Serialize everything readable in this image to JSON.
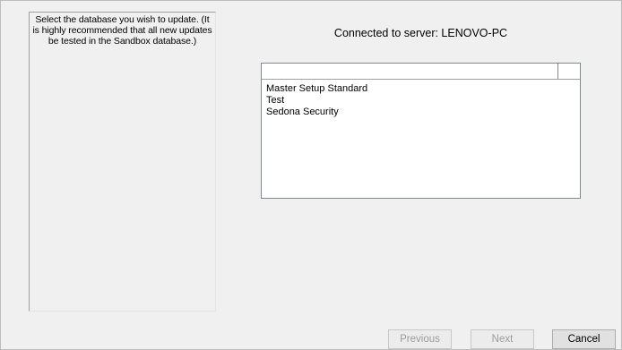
{
  "instructions": {
    "text": "Select the database you wish to update. (It is highly recommended that all new updates be tested in the Sandbox database.)"
  },
  "server": {
    "label": "Connected to server: LENOVO-PC"
  },
  "database_list": {
    "columns": [
      "",
      ""
    ],
    "items": [
      {
        "label": "Master Setup Standard"
      },
      {
        "label": "Test"
      },
      {
        "label": "Sedona Security"
      }
    ]
  },
  "buttons": {
    "previous": {
      "label": "Previous",
      "enabled": false
    },
    "next": {
      "label": "Next",
      "enabled": false
    },
    "cancel": {
      "label": "Cancel",
      "enabled": true
    }
  }
}
